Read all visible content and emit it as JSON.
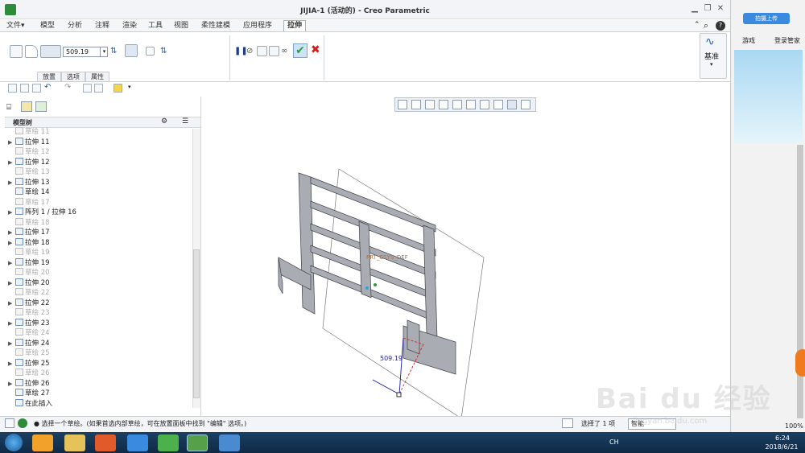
{
  "window": {
    "title": "JIJIA-1 (活动的) - Creo Parametric"
  },
  "menu": {
    "tabs": [
      "文件▾",
      "模型",
      "分析",
      "注释",
      "渲染",
      "工具",
      "视图",
      "柔性建模",
      "应用程序",
      "拉伸"
    ],
    "active": "拉伸"
  },
  "ribbon": {
    "depth_value": "509.19",
    "subtabs": [
      "放置",
      "选项",
      "属性"
    ],
    "datum_label": "基准"
  },
  "tree": {
    "title": "模型树",
    "rows": [
      {
        "label": "草绘 11",
        "dim": true,
        "arrow": false
      },
      {
        "label": "拉伸 11",
        "dim": false,
        "arrow": true
      },
      {
        "label": "草绘 12",
        "dim": true,
        "arrow": false
      },
      {
        "label": "拉伸 12",
        "dim": false,
        "arrow": true
      },
      {
        "label": "草绘 13",
        "dim": true,
        "arrow": false
      },
      {
        "label": "拉伸 13",
        "dim": false,
        "arrow": true
      },
      {
        "label": "草绘 14",
        "dim": false,
        "arrow": false
      },
      {
        "label": "草绘 17",
        "dim": true,
        "arrow": false
      },
      {
        "label": "阵列 1 / 拉伸 16",
        "dim": false,
        "arrow": true
      },
      {
        "label": "草绘 18",
        "dim": true,
        "arrow": false
      },
      {
        "label": "拉伸 17",
        "dim": false,
        "arrow": true
      },
      {
        "label": "拉伸 18",
        "dim": false,
        "arrow": true
      },
      {
        "label": "草绘 19",
        "dim": true,
        "arrow": false
      },
      {
        "label": "拉伸 19",
        "dim": false,
        "arrow": true
      },
      {
        "label": "草绘 20",
        "dim": true,
        "arrow": false
      },
      {
        "label": "拉伸 20",
        "dim": false,
        "arrow": true
      },
      {
        "label": "草绘 22",
        "dim": true,
        "arrow": false
      },
      {
        "label": "拉伸 22",
        "dim": false,
        "arrow": true
      },
      {
        "label": "草绘 23",
        "dim": true,
        "arrow": false
      },
      {
        "label": "拉伸 23",
        "dim": false,
        "arrow": true
      },
      {
        "label": "草绘 24",
        "dim": true,
        "arrow": false
      },
      {
        "label": "拉伸 24",
        "dim": false,
        "arrow": true
      },
      {
        "label": "草绘 25",
        "dim": true,
        "arrow": false
      },
      {
        "label": "拉伸 25",
        "dim": false,
        "arrow": true
      },
      {
        "label": "草绘 26",
        "dim": true,
        "arrow": false
      },
      {
        "label": "拉伸 26",
        "dim": false,
        "arrow": true
      },
      {
        "label": "草绘 27",
        "dim": false,
        "arrow": false
      },
      {
        "label": "在此插入",
        "dim": false,
        "arrow": false
      }
    ]
  },
  "graphics": {
    "dimension": "509.19",
    "feature_label": "PRT_CSYS_DEF"
  },
  "status": {
    "message": "● 选择一个草绘。(如果首选内部草绘，可在放置面板中找到 \"编辑\" 选项。)",
    "selected": "选择了 1 项",
    "filter": "智能"
  },
  "browser": {
    "upload": "拍摄上传",
    "games": "游戏",
    "login": "登录管家",
    "zoom": "100%"
  },
  "taskbar": {
    "time": "6:24",
    "date": "2018/6/21",
    "lang": "CH"
  },
  "watermark": {
    "text": "Bai du 经验",
    "url": "jingyan.baidu.com"
  },
  "colors": {
    "accent": "#f07a1e",
    "check": "#1fa83a",
    "cancel": "#d22020",
    "taskbar": "#143656"
  }
}
